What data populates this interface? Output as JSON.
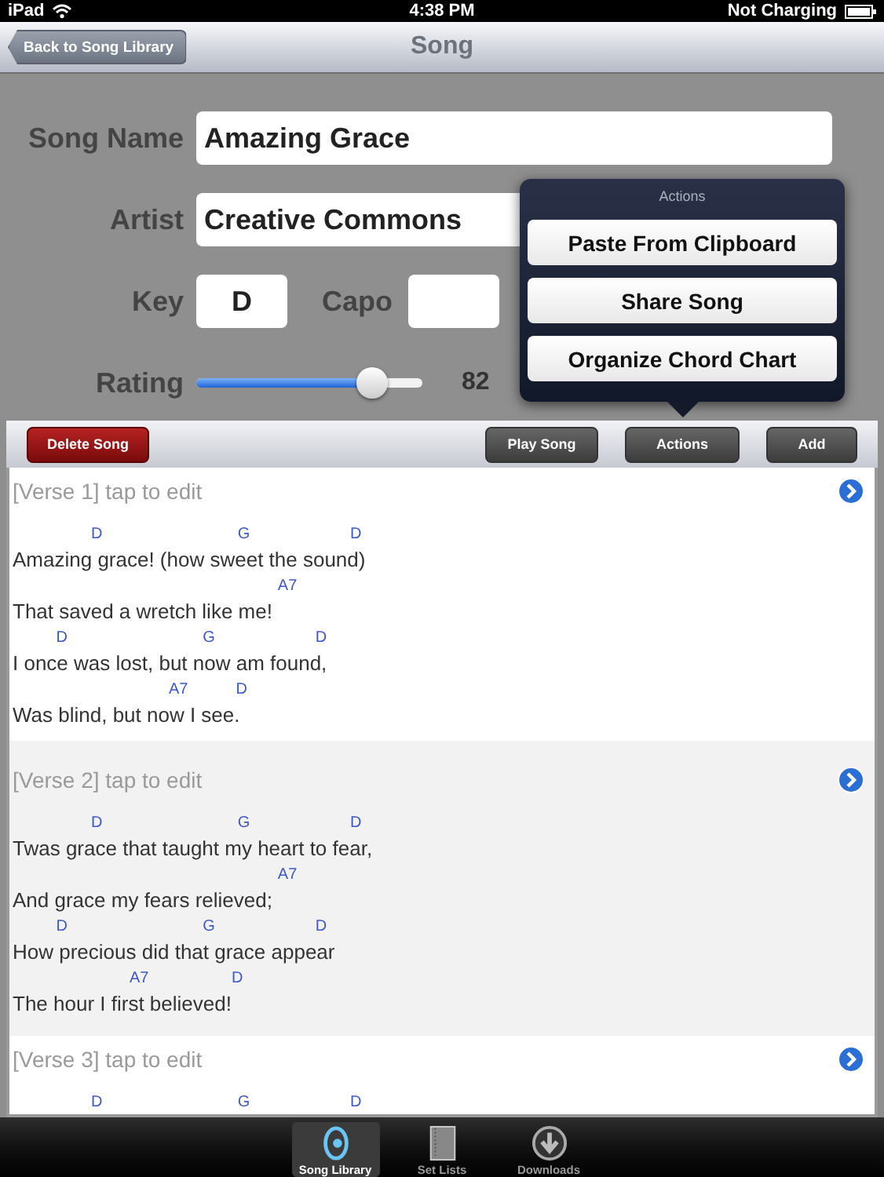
{
  "status_bar": {
    "device": "iPad",
    "time": "4:38 PM",
    "battery": "Not Charging"
  },
  "nav_bar": {
    "back": "Back to Song Library",
    "title": "Song"
  },
  "form": {
    "song_name": {
      "label": "Song Name",
      "value": "Amazing Grace"
    },
    "artist": {
      "label": "Artist",
      "value": "Creative Commons"
    },
    "key": {
      "label": "Key",
      "value": "D"
    },
    "capo": {
      "label": "Capo"
    },
    "rating": {
      "label": "Rating",
      "level": 0.78,
      "reading": "82"
    }
  },
  "popover": {
    "title": "Actions",
    "items": [
      "Paste From Clipboard",
      "Share Song",
      "Organize Chord Chart"
    ]
  },
  "toolbar": {
    "delete": "Delete Song",
    "buttons": [
      "Play Song",
      "Actions",
      "Add"
    ]
  },
  "verses": [
    {
      "header": "[Verse 1] tap to edit",
      "lines": [
        {
          "chords": "                  D                               G                       D",
          "lyric": "Amazing grace! (how sweet the sound)"
        },
        {
          "chords": "                                                             A7",
          "lyric": "That saved a wretch like me!"
        },
        {
          "chords": "          D                               G                       D",
          "lyric": "I once was lost, but now am found,"
        },
        {
          "chords": "                                    A7           D",
          "lyric": "Was blind, but now I see."
        }
      ]
    },
    {
      "header": "[Verse 2] tap to edit",
      "lines": [
        {
          "chords": "                  D                               G                       D",
          "lyric": "Twas grace that taught my heart to fear,"
        },
        {
          "chords": "                                                             A7",
          "lyric": "And grace my fears relieved;"
        },
        {
          "chords": "          D                               G                       D",
          "lyric": "How precious did that grace appear"
        },
        {
          "chords": "                           A7                   D",
          "lyric": "The hour I first believed!"
        }
      ]
    },
    {
      "header": "[Verse 3] tap to edit",
      "lines": [
        {
          "chords": "                  D                               G                       D"
        }
      ]
    }
  ],
  "tab_bar": [
    {
      "label": "Song Library",
      "kind": "library",
      "selected": true
    },
    {
      "label": "Set Lists",
      "kind": "book",
      "selected": false
    },
    {
      "label": "Downloads",
      "kind": "download",
      "selected": false
    }
  ]
}
